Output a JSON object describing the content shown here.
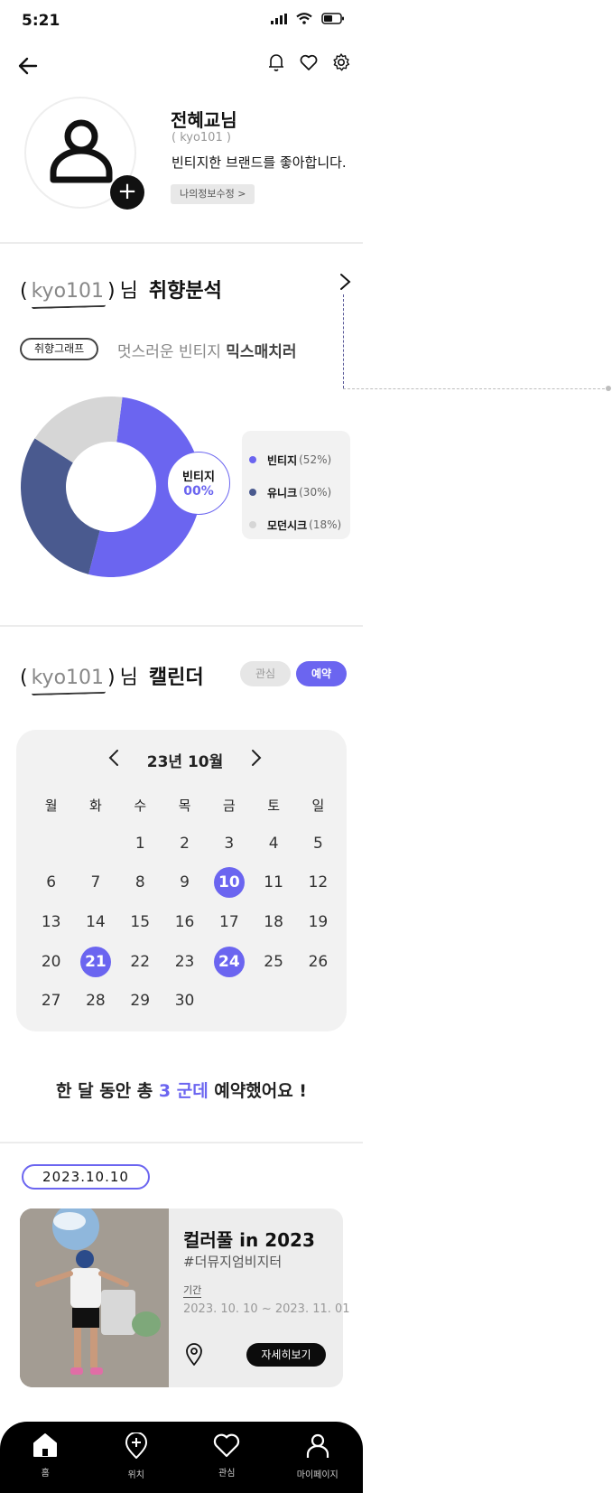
{
  "status_bar": {
    "time": "5:21"
  },
  "profile": {
    "name": "전혜교님",
    "user_id": "( kyo101 )",
    "bio": "빈티지한 브랜드를 좋아합니다.",
    "edit_label": "나의정보수정 >"
  },
  "taste": {
    "paren_open": "(",
    "uid": "kyo101",
    "paren_close": ")",
    "nim": "님",
    "title": "취향분석",
    "graph_pill": "취향그래프",
    "desc_prefix": "멋스러운 빈티지",
    "desc_bold": "믹스매치러",
    "bubble_label": "빈티지",
    "bubble_value": "00%",
    "legend": [
      {
        "name": "빈티지",
        "pct": "(52%)",
        "color": "#6b65f0"
      },
      {
        "name": "유니크",
        "pct": "(30%)",
        "color": "#4a5a8f"
      },
      {
        "name": "모던시크",
        "pct": "(18%)",
        "color": "#d6d6d6"
      }
    ]
  },
  "chart_data": {
    "type": "pie",
    "categories": [
      "빈티지",
      "유니크",
      "모던시크"
    ],
    "values": [
      52,
      30,
      18
    ],
    "colors": [
      "#6b65f0",
      "#4a5a8f",
      "#d6d6d6"
    ]
  },
  "calendar": {
    "paren_open": "(",
    "uid": "kyo101",
    "paren_close": ")",
    "nim": "님",
    "title": "캘린더",
    "toggle_interest": "관심",
    "toggle_reserve": "예약",
    "month_label": "23년 10월",
    "weekdays": [
      "월",
      "화",
      "수",
      "목",
      "금",
      "토",
      "일"
    ],
    "days": [
      "",
      "",
      "1",
      "2",
      "3",
      "4",
      "5",
      "6",
      "7",
      "8",
      "9",
      "10",
      "11",
      "12",
      "13",
      "14",
      "15",
      "16",
      "17",
      "18",
      "19",
      "20",
      "21",
      "22",
      "23",
      "24",
      "25",
      "26",
      "27",
      "28",
      "29",
      "30",
      "",
      "",
      ""
    ],
    "selected": [
      "10",
      "21",
      "24"
    ]
  },
  "summary": {
    "prefix": "한 달 동안 총 ",
    "count": "3 군데",
    "suffix": " 예약했어요 !"
  },
  "event": {
    "date": "2023.10.10",
    "title": "컬러풀 in 2023",
    "tag": "#더뮤지엄비지터",
    "period_label": "기간",
    "period": "2023. 10. 10 ~ 2023. 11. 01",
    "detail_button": "자세히보기"
  },
  "tabbar": {
    "home": "홈",
    "location": "위치",
    "interest": "관심",
    "mypage": "마이페이지"
  }
}
